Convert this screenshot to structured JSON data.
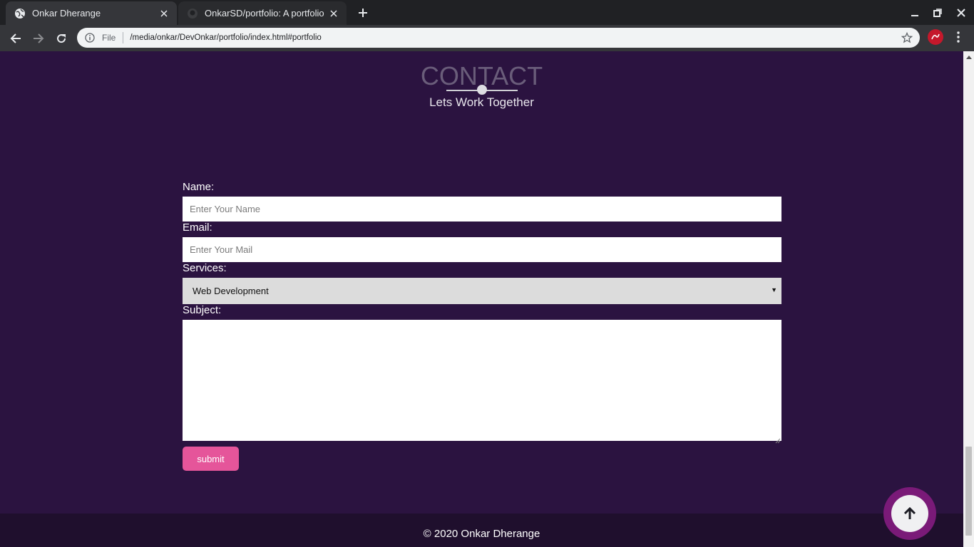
{
  "browser": {
    "tabs": [
      {
        "title": "Onkar Dherange",
        "active": true
      },
      {
        "title": "OnkarSD/portfolio: A portfolio",
        "active": false
      }
    ],
    "address": {
      "scheme": "File",
      "url": "/media/onkar/DevOnkar/portfolio/index.html#portfolio"
    },
    "colors": {
      "tabstrip": "#202124",
      "toolbar": "#35363a",
      "profile": "#c5182b"
    }
  },
  "contact": {
    "title": "CONTACT",
    "subtitle": "Lets Work Together",
    "name_label": "Name:",
    "name_placeholder": "Enter Your Name",
    "email_label": "Email:",
    "email_placeholder": "Enter Your Mail",
    "services_label": "Services:",
    "services_selected": "Web Development",
    "subject_label": "Subject:",
    "submit_label": "submit"
  },
  "footer": {
    "text": "© 2020 Onkar Dherange"
  },
  "colors": {
    "page_bg": "#2b1340",
    "footer_bg": "#1f0f2d",
    "submit_bg": "#e5559a",
    "scroll_top_ring": "#7a1a78"
  },
  "icons": [
    "globe-icon",
    "github-icon",
    "close-icon",
    "plus-icon",
    "minimize-icon",
    "restore-icon",
    "back-arrow-icon",
    "forward-arrow-icon",
    "reload-icon",
    "info-icon",
    "star-icon",
    "profile-avatar",
    "kebab-menu-icon",
    "arrow-up-icon"
  ]
}
